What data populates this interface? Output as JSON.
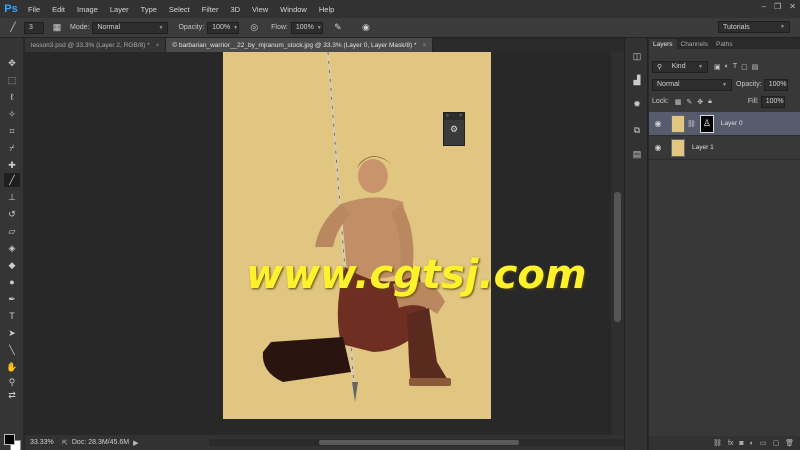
{
  "app": {
    "logo": "Ps",
    "menu": [
      "File",
      "Edit",
      "Image",
      "Layer",
      "Type",
      "Select",
      "Filter",
      "3D",
      "View",
      "Window",
      "Help"
    ]
  },
  "options": {
    "brush_size": "3",
    "mode_label": "Mode:",
    "mode_value": "Normal",
    "opacity_label": "Opacity:",
    "opacity_value": "100%",
    "flow_label": "Flow:",
    "flow_value": "100%",
    "workspace": "Tutorials"
  },
  "tabs": [
    {
      "label": "lesson3.psd @ 33.3% (Layer 2, RGB/8) *",
      "active": false
    },
    {
      "label": "© barbarian_warrior__22_by_mjranum_stock.jpg @ 33.3% (Layer 0, Layer Mask/8) *",
      "active": true
    }
  ],
  "status": {
    "zoom": "33.33%",
    "doc_info": "Doc: 28.3M/45.6M"
  },
  "canvas": {
    "background_color": "#e0c680"
  },
  "layers_panel": {
    "tabs": [
      "Layers",
      "Channels",
      "Paths"
    ],
    "filter_label": "Kind",
    "blend_mode": "Normal",
    "opacity_label": "Opacity:",
    "opacity_value": "100%",
    "lock_label": "Lock:",
    "fill_label": "Fill:",
    "fill_value": "100%",
    "layers": [
      {
        "name": "Layer 0",
        "selected": true,
        "has_mask": true
      },
      {
        "name": "Layer 1",
        "selected": false,
        "has_mask": false
      }
    ],
    "layer1_swatch": "#e0c680"
  },
  "watermark": "www.cgtsj.com"
}
